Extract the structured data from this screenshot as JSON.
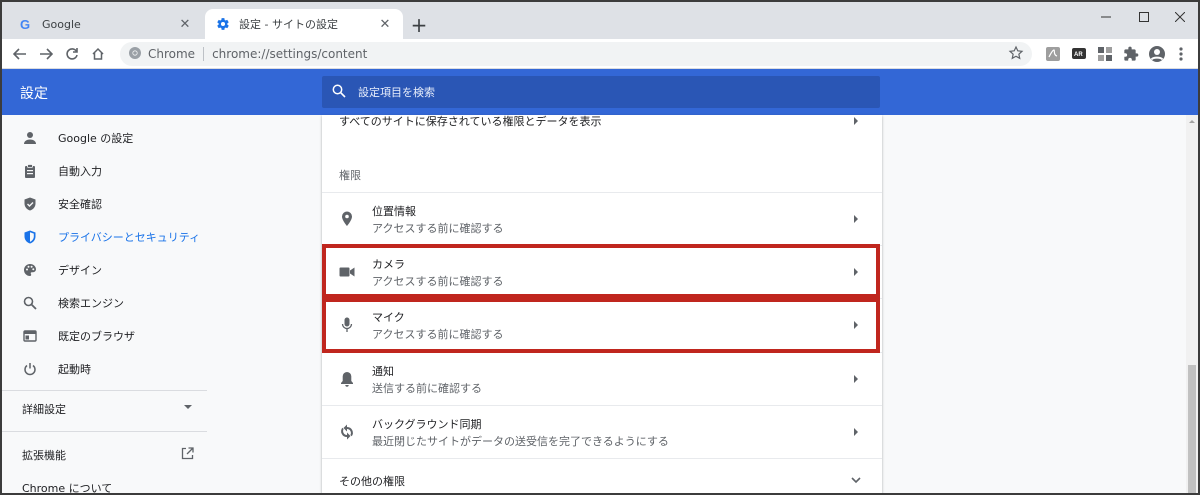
{
  "tabs": [
    {
      "title": "Google",
      "close": "✕"
    },
    {
      "title": "設定 - サイトの設定",
      "close": "✕"
    }
  ],
  "new_tab": "+",
  "toolbar": {
    "chip": "Chrome",
    "url": "chrome://settings/content"
  },
  "header": {
    "title": "設定",
    "search_placeholder": "設定項目を検索"
  },
  "sidebar": {
    "items": [
      {
        "label": "Google の設定",
        "icon": "person-icon"
      },
      {
        "label": "自動入力",
        "icon": "clipboard-icon"
      },
      {
        "label": "安全確認",
        "icon": "shield-check-icon"
      },
      {
        "label": "プライバシーとセキュリティ",
        "icon": "shield-icon"
      },
      {
        "label": "デザイン",
        "icon": "palette-icon"
      },
      {
        "label": "検索エンジン",
        "icon": "search-icon"
      },
      {
        "label": "既定のブラウザ",
        "icon": "browser-icon"
      },
      {
        "label": "起動時",
        "icon": "power-icon"
      }
    ],
    "advanced": "詳細設定",
    "extensions": "拡張機能",
    "about": "Chrome について"
  },
  "content": {
    "top_row": "すべてのサイトに保存されている権限とデータを表示",
    "section_label": "権限",
    "rows": [
      {
        "title": "位置情報",
        "subtitle": "アクセスする前に確認する",
        "icon": "location-icon"
      },
      {
        "title": "カメラ",
        "subtitle": "アクセスする前に確認する",
        "icon": "camera-icon"
      },
      {
        "title": "マイク",
        "subtitle": "アクセスする前に確認する",
        "icon": "mic-icon"
      },
      {
        "title": "通知",
        "subtitle": "送信する前に確認する",
        "icon": "bell-icon"
      },
      {
        "title": "バックグラウンド同期",
        "subtitle": "最近閉じたサイトがデータの送受信を完了できるようにする",
        "icon": "sync-icon"
      }
    ],
    "more": "その他の権限"
  },
  "colors": {
    "header": "#3367d6",
    "accent": "#1a73e8",
    "highlight": "#c0261e"
  }
}
